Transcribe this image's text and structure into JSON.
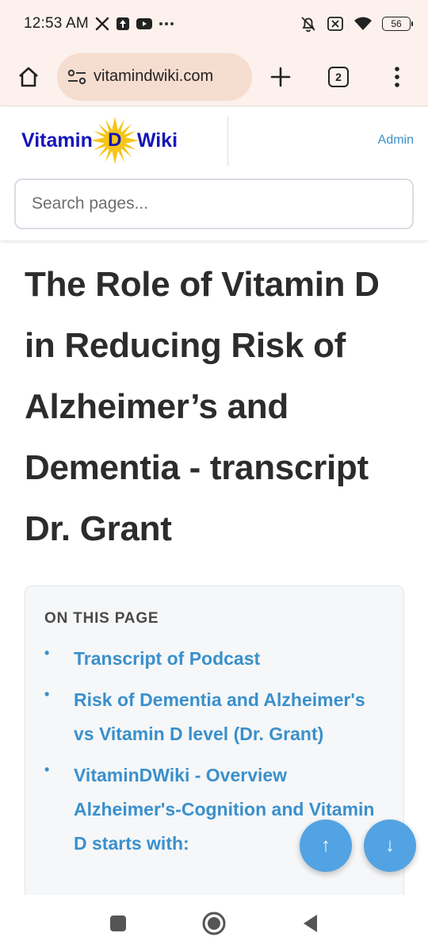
{
  "status_bar": {
    "time": "12:53 AM",
    "icons": [
      "x-logo-icon",
      "upload-icon",
      "youtube-icon",
      "more-dots-icon"
    ],
    "right_icons": [
      "bell-muted-icon",
      "sim-disabled-icon",
      "wifi-icon"
    ],
    "battery": "56"
  },
  "browser": {
    "url": "vitamindwiki.com",
    "tab_count": "2",
    "icons": {
      "home": "home-icon",
      "site_info": "site-settings-icon",
      "new_tab": "plus-icon",
      "menu": "kebab-menu-icon"
    }
  },
  "site": {
    "logo": {
      "left": "Vitamin",
      "middle": "D",
      "right": "Wiki"
    },
    "admin_label": "Admin",
    "search_placeholder": "Search pages..."
  },
  "article": {
    "title": "The Role of Vitamin D in Reducing Risk of Alzheimer’s and Dementia - transcript Dr. Grant"
  },
  "toc": {
    "heading": "ON THIS PAGE",
    "items": [
      {
        "label": "Transcript of Podcast"
      },
      {
        "label": "Risk of Dementia and Alzheimer's vs Vitamin D level (Dr. Grant)"
      },
      {
        "label": "VitaminDWiki - Overview Alzheimer's-Cognition and Vitamin D starts with:"
      }
    ]
  },
  "fabs": {
    "up": "↑",
    "down": "↓"
  },
  "nav": {
    "icons": [
      "recents-square-icon",
      "home-circle-icon",
      "back-triangle-icon"
    ]
  },
  "colors": {
    "browser_chrome": "#fcf1ec",
    "url_pill": "#f5ddd0",
    "logo_blue": "#1515b8",
    "sun_yellow": "#f5c518",
    "link_blue": "#3a90cc",
    "fab_blue": "#4a9fe2"
  }
}
